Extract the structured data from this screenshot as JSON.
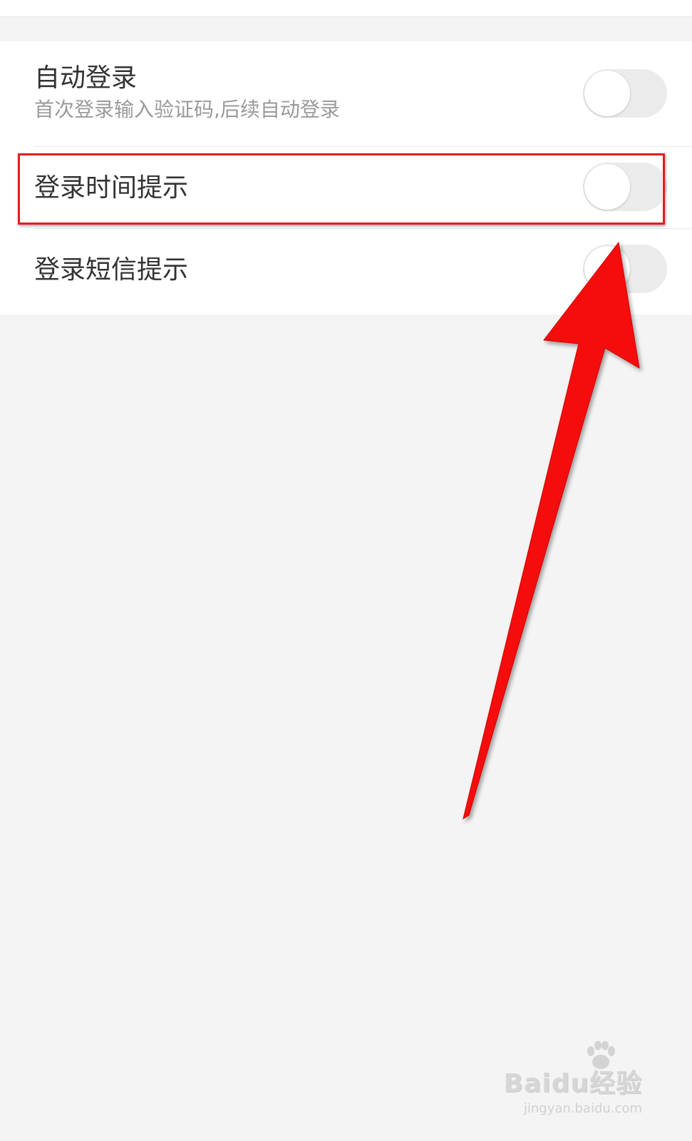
{
  "settings": {
    "items": [
      {
        "title": "自动登录",
        "subtitle": "首次登录输入验证码,后续自动登录",
        "enabled": false
      },
      {
        "title": "登录时间提示",
        "enabled": false
      },
      {
        "title": "登录短信提示",
        "enabled": false
      }
    ]
  },
  "annotation": {
    "highlight_color": "#e41e1e",
    "arrow_color": "#f50a0a"
  },
  "watermark": {
    "brand_text": "Baidu经验",
    "url": "jingyan.baidu.com"
  },
  "colors": {
    "background": "#f4f4f4",
    "card": "#ffffff",
    "title_text": "#333333",
    "subtitle_text": "#9a9a9a",
    "toggle_off_track": "#ebebeb"
  }
}
